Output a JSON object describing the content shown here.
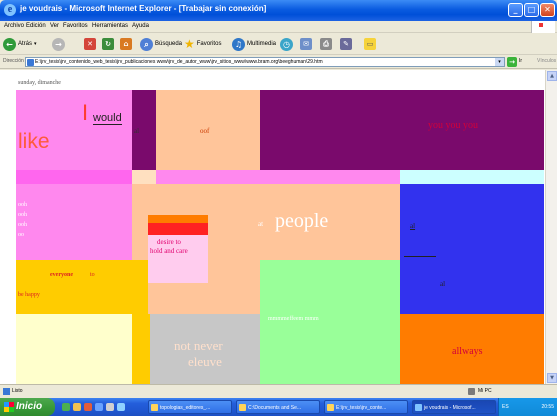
{
  "window": {
    "title": "je voudrais - Microsoft Internet Explorer - [Trabajar sin conexión]",
    "controls": {
      "minimize": "_",
      "maximize": "□",
      "close": "✕"
    }
  },
  "menu": [
    "Archivo",
    "Edición",
    "Ver",
    "Favoritos",
    "Herramientas",
    "Ayuda"
  ],
  "toolbar": {
    "back_label": "Atrás",
    "search_label": "Búsqueda",
    "favorites_label": "Favoritos",
    "multimedia_label": "Multimedia"
  },
  "address": {
    "label": "Dirección",
    "url": "E:\\jrv_tesis\\jrv_contenido_web_tesis\\jrv_publicaciones www\\jrv_de_autor_www\\jrv_sitios_www\\www.bram.org\\beeghuman\\29.htm",
    "go_label": "Ir",
    "links_label": "Vínculos"
  },
  "content": {
    "top_text": "sunday, dimanche",
    "i": "I",
    "would": "would",
    "like": "like",
    "oof": "oof",
    "you_you": "you you you",
    "ooh_lines": [
      "ooh",
      "ooh",
      "ooh",
      "oo"
    ],
    "people": "people",
    "at": "at",
    "desire_line1": "desire to",
    "desire_line2": "hold and care",
    "everyone": "everyone",
    "everyone_suffix": "to",
    "be_happy": "be happy",
    "never_line1": "not never",
    "never_line2": "eleuve",
    "mess_line": "mmmmeffeem mmm",
    "allways": "allways",
    "small_left_a": "al",
    "small_left_b": "al",
    "small_left_c": "al",
    "colors": {
      "pink": "#ff88ee",
      "purple": "#7a0a6c",
      "peach": "#ffc59a",
      "blue": "#3232ee",
      "light_green": "#99ff99",
      "orange": "#ff7c00",
      "cream": "#ffffcc",
      "gold": "#ffcc00",
      "gray": "#c7c7c7",
      "red": "#ff2222"
    }
  },
  "status": {
    "text": "Listo",
    "zone": "Mi PC"
  },
  "taskbar": {
    "start_label": "Inicio",
    "tasks": [
      "topologias_editores_...",
      "C:\\Documents and Se...",
      "E:\\jrv_tesis\\jrv_conte...",
      "je voudrais - Microsof..."
    ],
    "lang": "ES",
    "clock": "20:55"
  }
}
